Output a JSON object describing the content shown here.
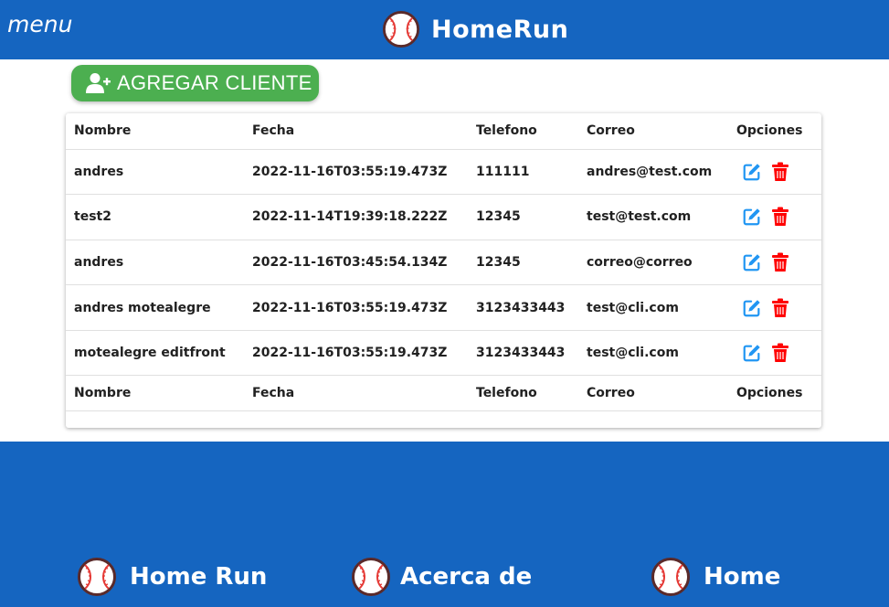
{
  "header": {
    "menu_label": "menu",
    "brand": "HomeRun",
    "brand_icon": "baseball-icon",
    "bg_color": "#1565c0"
  },
  "actions": {
    "add_client_label": "AGREGAR CLIENTE",
    "add_client_icon": "user-plus-icon",
    "color": "#4caf50"
  },
  "table": {
    "columns": [
      "Nombre",
      "Fecha",
      "Telefono",
      "Correo",
      "Opciones"
    ],
    "rows": [
      {
        "nombre": "andres",
        "fecha": "2022-11-16T03:55:19.473Z",
        "telefono": "111111",
        "correo": "andres@test.com"
      },
      {
        "nombre": "test2",
        "fecha": "2022-11-14T19:39:18.222Z",
        "telefono": "12345",
        "correo": "test@test.com"
      },
      {
        "nombre": "andres",
        "fecha": "2022-11-16T03:45:54.134Z",
        "telefono": "12345",
        "correo": "correo@correo"
      },
      {
        "nombre": "andres motealegre",
        "fecha": "2022-11-16T03:55:19.473Z",
        "telefono": "3123433443",
        "correo": "test@cli.com"
      },
      {
        "nombre": "motealegre editfront",
        "fecha": "2022-11-16T03:55:19.473Z",
        "telefono": "3123433443",
        "correo": "test@cli.com"
      }
    ],
    "edit_icon": "edit-icon",
    "delete_icon": "trash-icon",
    "edit_color": "#2196f3",
    "delete_color": "#ff0000"
  },
  "footer": {
    "links": [
      "Home Run",
      "Acerca de",
      "Home"
    ],
    "icon": "baseball-icon"
  }
}
